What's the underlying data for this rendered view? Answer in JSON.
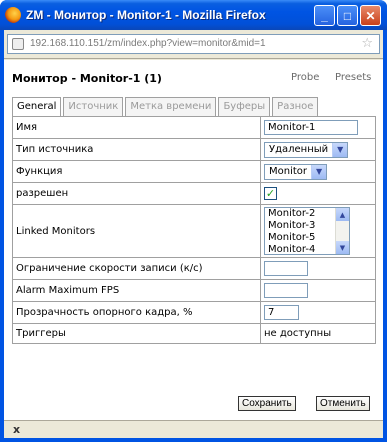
{
  "window": {
    "title": "ZM - Монитор - Monitor-1 - Mozilla Firefox"
  },
  "address_bar": {
    "url_host": "192.168.110.151",
    "url_path": "/zm/index.php?view=monitor&mid=1"
  },
  "page": {
    "heading": "Монитор - Monitor-1 (1)",
    "links": {
      "probe": "Probe",
      "presets": "Presets"
    }
  },
  "tabs": [
    {
      "label": "General",
      "active": true
    },
    {
      "label": "Источник",
      "active": false
    },
    {
      "label": "Метка времени",
      "active": false
    },
    {
      "label": "Буферы",
      "active": false
    },
    {
      "label": "Разное",
      "active": false
    }
  ],
  "form": {
    "name": {
      "label": "Имя",
      "value": "Monitor-1"
    },
    "source_type": {
      "label": "Тип источника",
      "value": "Удаленный"
    },
    "function": {
      "label": "Функция",
      "value": "Monitor"
    },
    "enabled": {
      "label": "разрешен",
      "checked": true
    },
    "linked_monitors": {
      "label": "Linked Monitors",
      "options": [
        "Monitor-2",
        "Monitor-3",
        "Monitor-5",
        "Monitor-4"
      ]
    },
    "max_fps": {
      "label": "Ограничение скорости записи (к/с)",
      "value": ""
    },
    "alarm_max_fps": {
      "label": "Alarm Maximum FPS",
      "value": ""
    },
    "ref_blend": {
      "label": "Прозрачность опорного кадра, %",
      "value": "7"
    },
    "triggers": {
      "label": "Триггеры",
      "value": "не доступны"
    }
  },
  "buttons": {
    "save": "Сохранить",
    "cancel": "Отменить"
  },
  "status": {
    "close_glyph": "x"
  }
}
